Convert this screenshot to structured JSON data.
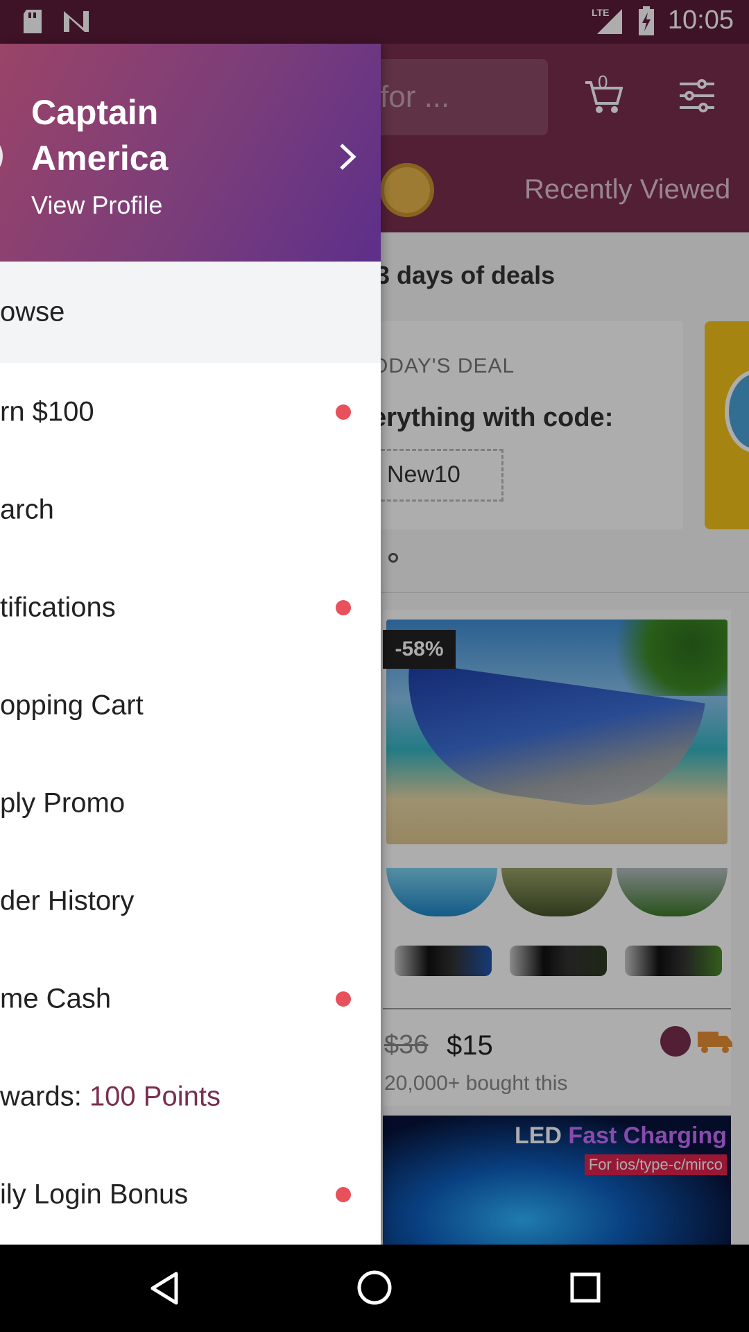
{
  "status_bar": {
    "time": "10:05",
    "network": "LTE",
    "icons": [
      "sd-card-icon",
      "n-notification-icon",
      "lte-signal-icon",
      "battery-charging-icon"
    ]
  },
  "background_app": {
    "search_placeholder": "for ...",
    "cart_count": "0",
    "recently_viewed": "Recently Viewed",
    "section_title": "3 days of deals",
    "deal": {
      "label": "ODAY'S DEAL",
      "text": "erything with code:",
      "code": "New10"
    },
    "product": {
      "discount": "-58%",
      "old_price": "$36",
      "price": "$15",
      "bought": "20,000+ bought this"
    },
    "product2": {
      "title_a": "LED ",
      "title_b": "Fast Charging",
      "subtitle": "For ios/type-c/mirco"
    }
  },
  "drawer": {
    "user_name": "Captain America",
    "view_profile": "View Profile",
    "items": [
      {
        "label": "owse",
        "dot": false
      },
      {
        "label": "rn $100",
        "dot": true
      },
      {
        "label": "arch",
        "dot": false
      },
      {
        "label": "tifications",
        "dot": true
      },
      {
        "label": "opping Cart",
        "dot": false
      },
      {
        "label": "ply Promo",
        "dot": false
      },
      {
        "label": "der History",
        "dot": false
      },
      {
        "label": "me Cash",
        "dot": true
      },
      {
        "label": "wards: ",
        "points": "100 Points",
        "dot": false
      },
      {
        "label": "ily Login Bonus",
        "dot": true
      }
    ]
  },
  "colors": {
    "brand": "#7a2e4e",
    "status_bar": "#5c1c3a",
    "dot": "#e8505b"
  }
}
